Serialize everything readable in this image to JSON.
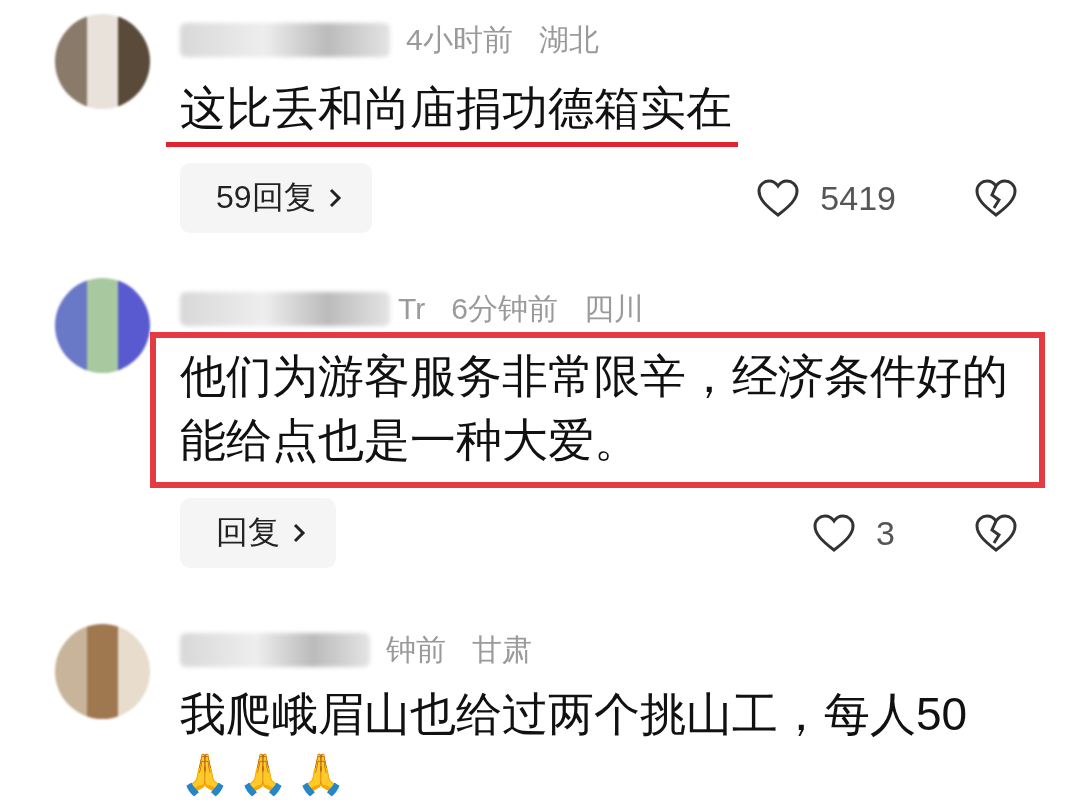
{
  "comments": [
    {
      "kind": "underlined",
      "time": "4小时前",
      "region": "湖北",
      "text": "这比丢和尚庙捐功德箱实在",
      "reply": "59回复",
      "likes": "5419"
    },
    {
      "kind": "boxed",
      "name_tail": "Tr",
      "time": "6分钟前",
      "region": "四川",
      "text": "他们为游客服务非常限辛，经济条件好的能给点也是一种大爱。",
      "reply": "回复",
      "likes": "3"
    },
    {
      "kind": "plain",
      "time": "钟前",
      "region": "甘肃",
      "text": "我爬峨眉山也给过两个挑山工，每人50",
      "emoji": "🙏🙏🙏"
    }
  ]
}
